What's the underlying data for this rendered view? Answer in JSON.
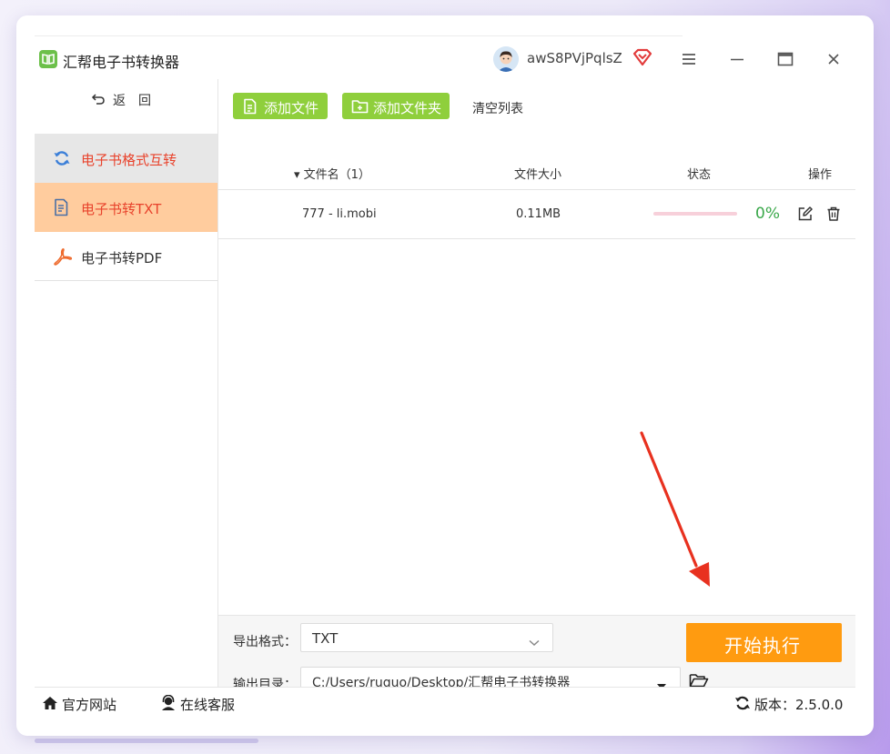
{
  "app": {
    "title": "汇帮电子书转换器",
    "username": "awS8PVjPqlsZ"
  },
  "sidebar": {
    "back_label": "返回",
    "items": [
      {
        "label": "电子书格式互转",
        "icon": "sync-icon"
      },
      {
        "label": "电子书转TXT",
        "icon": "document-icon"
      },
      {
        "label": "电子书转PDF",
        "icon": "pdf-icon"
      }
    ]
  },
  "toolbar": {
    "add_file_label": "添加文件",
    "add_folder_label": "添加文件夹",
    "clear_list_label": "清空列表"
  },
  "table": {
    "headers": {
      "name": "▾ 文件名（1）",
      "size": "文件大小",
      "status": "状态",
      "actions": "操作"
    },
    "rows": [
      {
        "name": "777 - li.mobi",
        "size": "0.11MB",
        "progress": 0,
        "percent": "0%"
      }
    ]
  },
  "output": {
    "format_label": "导出格式：",
    "format_value": "TXT",
    "dir_label": "输出目录：",
    "dir_value": "C:/Users/ruguo/Desktop/汇帮电子书转换器",
    "start_label": "开始执行"
  },
  "footer": {
    "website_label": "官方网站",
    "service_label": "在线客服",
    "version_label": "版本：2.5.0.0"
  },
  "colors": {
    "accent_green": "#8fcf3c",
    "active_nav_bg": "#ffcc9e",
    "active_text": "#e8432c",
    "start_button": "#ff9b10",
    "percent_green": "#3aa84a",
    "annotation_arrow": "#e8311f"
  }
}
